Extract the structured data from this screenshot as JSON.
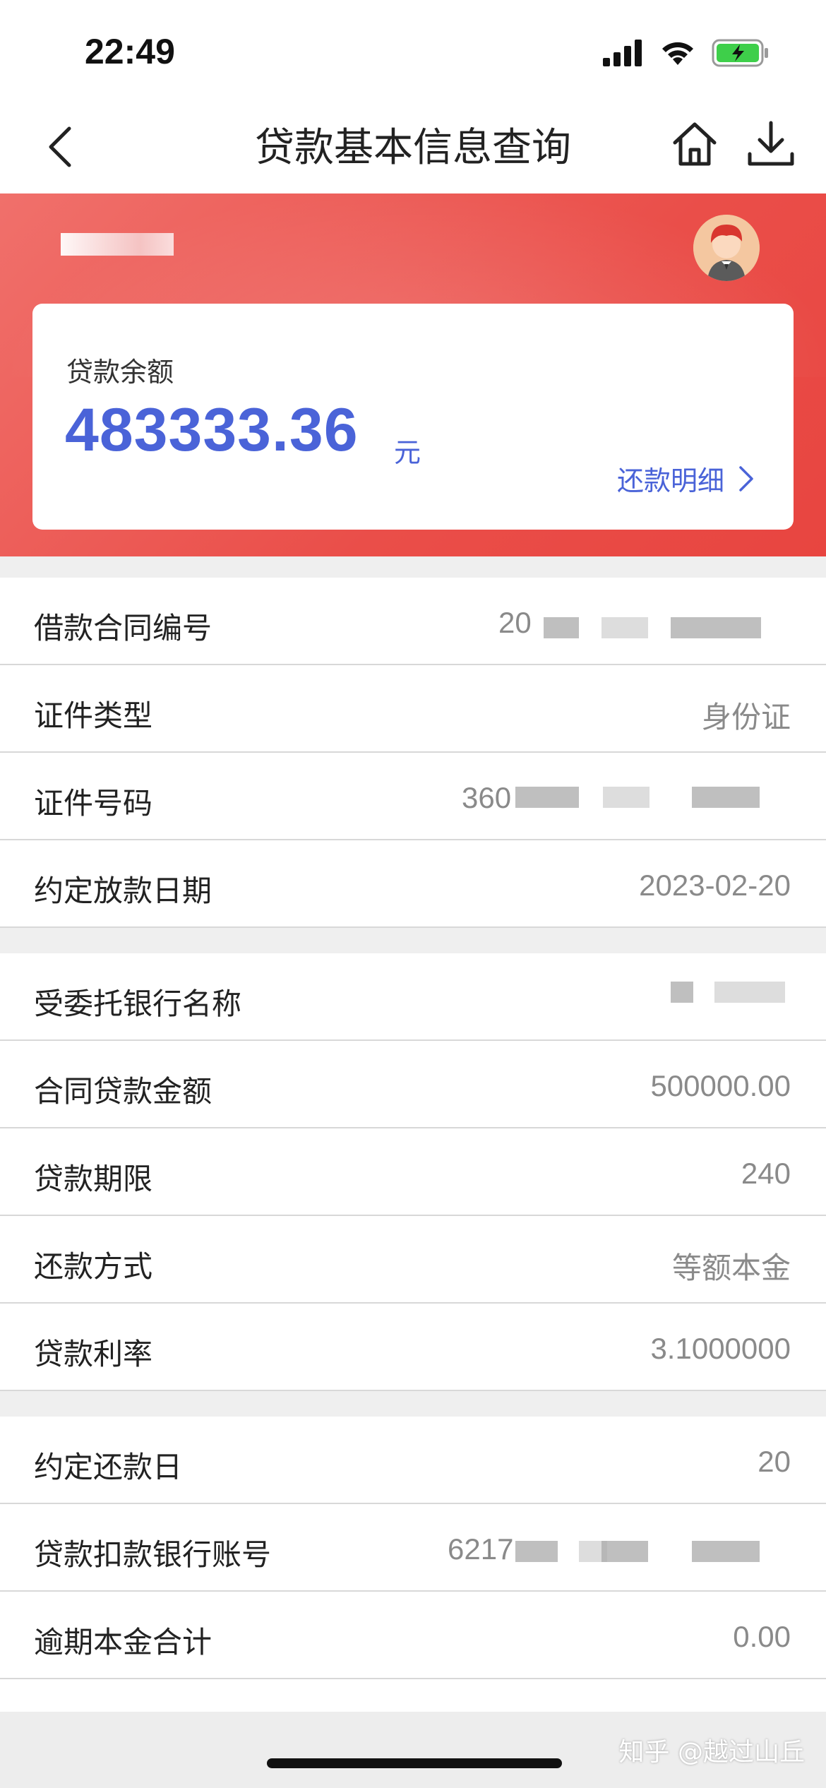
{
  "status_bar": {
    "time": "22:49"
  },
  "nav": {
    "title": "贷款基本信息查询",
    "back_icon": "chevron-left-icon",
    "home_icon": "home-icon",
    "download_icon": "download-icon"
  },
  "header": {
    "user_name_masked": "",
    "avatar_icon": "avatar-icon"
  },
  "balance_card": {
    "label": "贷款余额",
    "amount": "483333.36",
    "unit": "元",
    "detail_link": "还款明细"
  },
  "section1": [
    {
      "label": "借款合同编号",
      "value": "20"
    },
    {
      "label": "证件类型",
      "value": "身份证"
    },
    {
      "label": "证件号码",
      "value": "360"
    },
    {
      "label": "约定放款日期",
      "value": "2023-02-20"
    }
  ],
  "section2": [
    {
      "label": "受委托银行名称",
      "value": ""
    },
    {
      "label": "合同贷款金额",
      "value": "500000.00"
    },
    {
      "label": "贷款期限",
      "value": "240"
    },
    {
      "label": "还款方式",
      "value": "等额本金"
    },
    {
      "label": "贷款利率",
      "value": "3.1000000"
    }
  ],
  "section3": [
    {
      "label": "约定还款日",
      "value": "20"
    },
    {
      "label": "贷款扣款银行账号",
      "value": "6217"
    },
    {
      "label": "逾期本金合计",
      "value": "0.00"
    }
  ],
  "watermark": "知乎 @越过山丘",
  "colors": {
    "accent": "#4a63d8",
    "header_red": "#ea4e49"
  }
}
